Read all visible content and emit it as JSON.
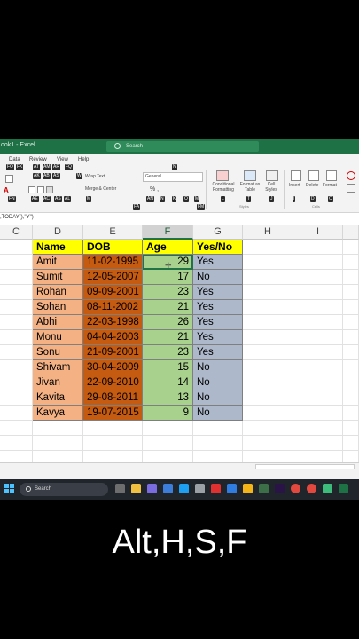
{
  "window": {
    "title": "ook1 - Excel",
    "search_placeholder": "Search"
  },
  "ribbon": {
    "tabs": [
      "Data",
      "Review",
      "View",
      "Help"
    ],
    "tab_keytips": [
      "FO",
      "FK",
      "AT",
      "AM",
      "AR",
      "FQ"
    ],
    "keytips_row2": [
      "AK",
      "AB",
      "AS",
      "W"
    ],
    "keytips_row3": [
      "AE",
      "AC",
      "AS",
      "AL",
      "M"
    ],
    "keytips_row4": [
      "AN",
      "N",
      "K",
      "O",
      "M"
    ],
    "keytips_styles": [
      "L",
      "T",
      "J"
    ],
    "keytips_cells": [
      "I",
      "D",
      "O"
    ],
    "number_format_keytip": "N",
    "font_keytip": "FN",
    "alignment_keytip": "FA",
    "number_keytip": "FM",
    "wrap_text": "Wrap Text",
    "merge_center": "Merge & Center",
    "number_format_value": "General",
    "conditional_formatting": "Conditional Formatting",
    "format_as_table": "Format as Table",
    "cell_styles": "Cell Styles",
    "styles_group": "Styles",
    "insert": "Insert",
    "delete": "Delete",
    "format": "Format",
    "cells_group": "Cells"
  },
  "formula_bar": {
    "formula": ",TODAY(),\"Y\")"
  },
  "sheet": {
    "columns": [
      "C",
      "D",
      "E",
      "F",
      "G",
      "H",
      "I"
    ],
    "selected_column": "F",
    "headers": [
      "Name",
      "DOB",
      "Age",
      "Yes/No"
    ],
    "rows": [
      {
        "name": "Amit",
        "dob": "11-02-1995",
        "age": "29",
        "yes_no": "Yes"
      },
      {
        "name": "Sumit",
        "dob": "12-05-2007",
        "age": "17",
        "yes_no": "No"
      },
      {
        "name": "Rohan",
        "dob": "09-09-2001",
        "age": "23",
        "yes_no": "Yes"
      },
      {
        "name": "Sohan",
        "dob": "08-11-2002",
        "age": "21",
        "yes_no": "Yes"
      },
      {
        "name": "Abhi",
        "dob": "22-03-1998",
        "age": "26",
        "yes_no": "Yes"
      },
      {
        "name": "Monu",
        "dob": "04-04-2003",
        "age": "21",
        "yes_no": "Yes"
      },
      {
        "name": "Sonu",
        "dob": "21-09-2001",
        "age": "23",
        "yes_no": "Yes"
      },
      {
        "name": "Shivam",
        "dob": "30-04-2009",
        "age": "15",
        "yes_no": "No"
      },
      {
        "name": "Jivan",
        "dob": "22-09-2010",
        "age": "14",
        "yes_no": "No"
      },
      {
        "name": "Kavita",
        "dob": "29-08-2011",
        "age": "13",
        "yes_no": "No"
      },
      {
        "name": "Kavya",
        "dob": "19-07-2015",
        "age": "9",
        "yes_no": "No"
      }
    ],
    "colors": {
      "header": "#ffff00",
      "name": "#f4b183",
      "dob": "#c55a11",
      "age": "#a9d18e",
      "yes_no": "#adb9ca"
    }
  },
  "taskbar": {
    "search_placeholder": "Search"
  },
  "caption": "Alt,H,S,F"
}
